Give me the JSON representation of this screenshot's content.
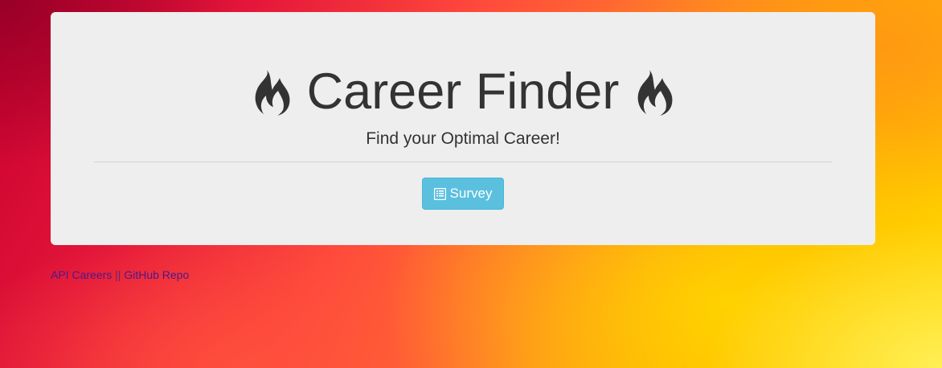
{
  "header": {
    "title": "Career Finder",
    "title_icon": "fire-icon",
    "subtitle": "Find your Optimal Career!"
  },
  "actions": {
    "survey_label": "Survey",
    "survey_icon": "list-alt-icon"
  },
  "footer": {
    "link1_label": "API Careers",
    "separator": "||",
    "link2_label": "GitHub Repo"
  },
  "colors": {
    "panel": "#eeeeee",
    "button": "#5bc0de",
    "text": "#333333",
    "link": "#4b1a8b"
  }
}
